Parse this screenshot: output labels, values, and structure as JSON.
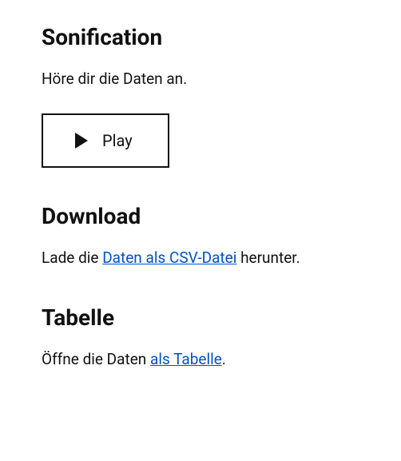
{
  "sonification": {
    "heading": "Sonification",
    "description": "Höre dir die Daten an.",
    "playLabel": "Play"
  },
  "download": {
    "heading": "Download",
    "textBefore": "Lade die ",
    "linkText": "Daten als CSV-Datei",
    "textAfter": " herunter."
  },
  "table": {
    "heading": "Tabelle",
    "textBefore": "Öffne die Daten ",
    "linkText": "als Tabelle",
    "textAfter": "."
  }
}
